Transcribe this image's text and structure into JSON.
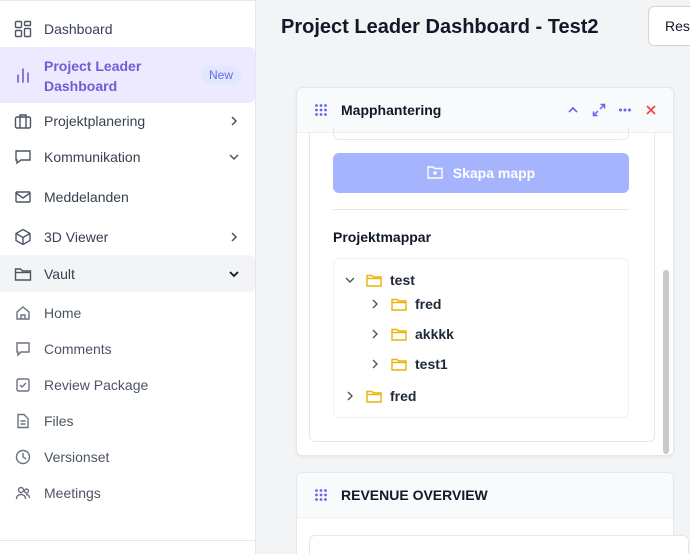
{
  "sidebar": {
    "items": [
      {
        "label": "Dashboard",
        "icon": "dashboard-grid-icon"
      },
      {
        "label": "Project Leader Dashboard",
        "icon": "bar-chart-icon",
        "badge": "New"
      },
      {
        "label": "Projektplanering",
        "icon": "briefcase-icon"
      },
      {
        "label": "Kommunikation",
        "icon": "chat-icon"
      },
      {
        "label": "Meddelanden",
        "icon": "mail-icon"
      },
      {
        "label": "3D Viewer",
        "icon": "cube-icon"
      },
      {
        "label": "Vault",
        "icon": "folder-icon"
      }
    ],
    "vault_items": [
      {
        "label": "Home",
        "icon": "home-icon"
      },
      {
        "label": "Comments",
        "icon": "comment-icon"
      },
      {
        "label": "Review Package",
        "icon": "checklist-icon"
      },
      {
        "label": "Files",
        "icon": "file-icon"
      },
      {
        "label": "Versionset",
        "icon": "clock-icon"
      },
      {
        "label": "Meetings",
        "icon": "people-icon"
      }
    ]
  },
  "header": {
    "title": "Project Leader Dashboard - Test2",
    "reset_label": "Reset"
  },
  "folder_card": {
    "title": "Mapphantering",
    "create_button": "Skapa mapp",
    "section_label": "Projektmappar",
    "tree": [
      {
        "label": "test",
        "expanded": true
      },
      {
        "label": "fred"
      },
      {
        "label": "akkkk"
      },
      {
        "label": "test1"
      },
      {
        "label": "fred"
      }
    ]
  },
  "revenue_card": {
    "title": "REVENUE OVERVIEW"
  },
  "colors": {
    "accent": "#6d5fd3",
    "accent_light": "#ede9fe",
    "button_disabled": "#a5b4fc",
    "folder_yellow": "#eab308",
    "close_red": "#ef4444",
    "header_icon": "#6366f1"
  }
}
